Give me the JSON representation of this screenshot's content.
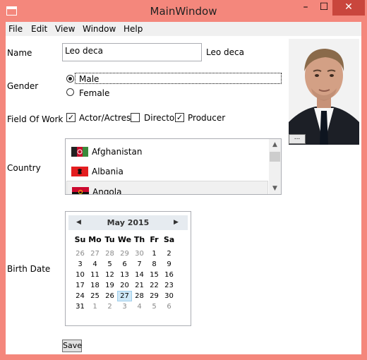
{
  "window": {
    "title": "MainWindow",
    "minimize_glyph": "–",
    "maximize_glyph": "☐",
    "close_glyph": "✕"
  },
  "menu": [
    "File",
    "Edit",
    "View",
    "Window",
    "Help"
  ],
  "form": {
    "name_label": "Name",
    "name_value": "Leo deca",
    "name_echo": "Leo deca",
    "gender_label": "Gender",
    "gender_options": [
      "Male",
      "Female"
    ],
    "gender_selected": "Male",
    "field_label": "Field Of Work",
    "fields": [
      {
        "label": "Actor/Actress",
        "checked": true
      },
      {
        "label": "Director",
        "checked": false
      },
      {
        "label": "Producer",
        "checked": true
      }
    ],
    "country_label": "Country",
    "countries": [
      "Afghanistan",
      "Albania",
      "Angola"
    ],
    "country_selected": "Angola",
    "birth_label": "Birth Date",
    "browse_label": "...",
    "save_label": "Save"
  },
  "calendar": {
    "title": "May 2015",
    "dow": [
      "Su",
      "Mo",
      "Tu",
      "We",
      "Th",
      "Fr",
      "Sa"
    ],
    "weeks": [
      [
        "26",
        "27",
        "28",
        "29",
        "30",
        "1",
        "2"
      ],
      [
        "3",
        "4",
        "5",
        "6",
        "7",
        "8",
        "9"
      ],
      [
        "10",
        "11",
        "12",
        "13",
        "14",
        "15",
        "16"
      ],
      [
        "17",
        "18",
        "19",
        "20",
        "21",
        "22",
        "23"
      ],
      [
        "24",
        "25",
        "26",
        "27",
        "28",
        "29",
        "30"
      ],
      [
        "31",
        "1",
        "2",
        "3",
        "4",
        "5",
        "6"
      ]
    ],
    "selected": "27"
  },
  "colors": {
    "window_frame": "#f4877c",
    "close_button": "#c9463d",
    "calendar_header": "#e6ebf0",
    "calendar_selected": "#cfe8f7"
  },
  "icons": {
    "prev": "triangle-left-icon",
    "next": "triangle-right-icon",
    "check": "check-icon"
  }
}
